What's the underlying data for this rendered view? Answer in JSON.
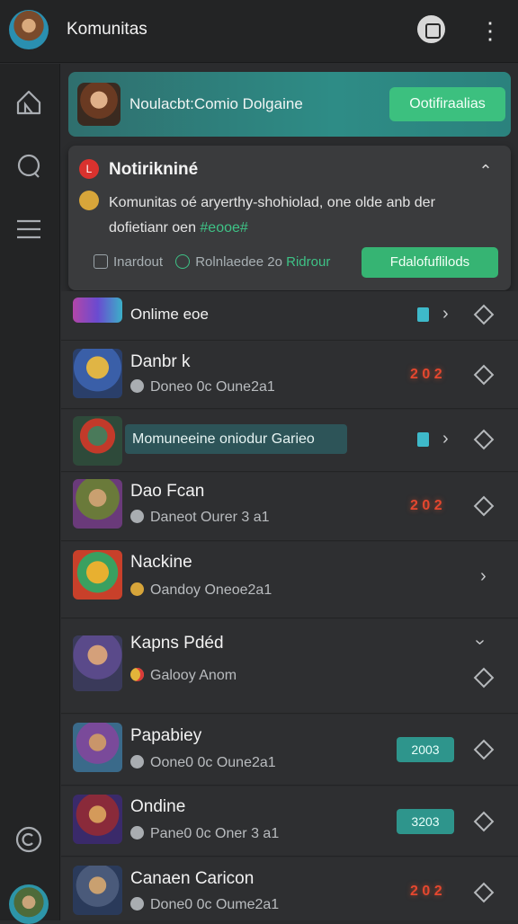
{
  "header": {
    "title": "Komunitas",
    "stop_icon": "stop-circle-icon",
    "more_icon": "more-vertical-icon"
  },
  "rail": {
    "icons": [
      "home-icon",
      "chat-icon",
      "list-icon",
      "settings-icon"
    ]
  },
  "banner": {
    "text": "Noulacbt:Comio Dolgaine",
    "button": "Ootifiraalias"
  },
  "notice": {
    "title": "Notirikniné",
    "badge": "L",
    "body_line1": "Komunitas oé aryerthy-shohiolad, one olde anb der",
    "body_line2_prefix": "dofietianr oen ",
    "body_line2_highlight": "#eooe#",
    "meta_left": "Inardout",
    "meta_mid": "Rolnlaedee 2o",
    "meta_right": "Ridrour",
    "button": "Fdalofuflilods"
  },
  "rows": [
    {
      "name": "Onlime eoe"
    },
    {
      "name": "Danbr k",
      "sub": "Doneo 0c Oune2a1",
      "badge": "2 0 2"
    },
    {
      "name": "Momuneeine oniodur Garieo"
    },
    {
      "name": "Dao Fcan",
      "sub": "Daneot Ourer 3 a1",
      "badge": "2 0 2"
    },
    {
      "name": "Nackine",
      "sub": "Oandoy Oneoe2a1"
    },
    {
      "name": "Kapns Pdéd",
      "sub": "Galooy Anom"
    },
    {
      "name": "Papabiey",
      "sub": "Oone0 0c Oune2a1",
      "badge": "2003"
    },
    {
      "name": "Ondine",
      "sub": "Pane0 0c Oner 3 a1",
      "badge": "3203"
    },
    {
      "name": "Canaen Caricon",
      "sub": "Done0 0c Oume2a1",
      "badge": "2 0 2"
    }
  ]
}
